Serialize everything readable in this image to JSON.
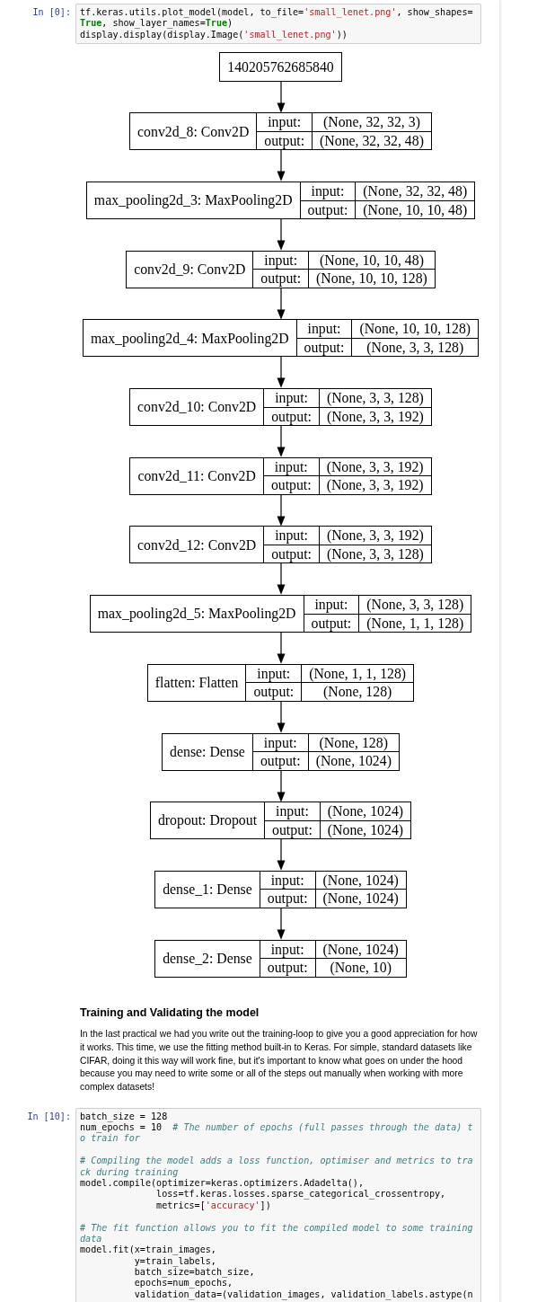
{
  "cells": [
    {
      "kind": "code",
      "prompt": "In [0]:",
      "blocks": [
        [
          [
            {
              "kind": "plain",
              "text": "tf.keras.utils.plot_model(model, to_file="
            },
            {
              "kind": "string",
              "text": "'small_lenet.png'"
            },
            {
              "kind": "plain",
              "text": ", show_shapes="
            }
          ],
          [
            {
              "kind": "keyword",
              "text": "True"
            },
            {
              "kind": "plain",
              "text": ", show_layer_names="
            },
            {
              "kind": "keyword",
              "text": "True"
            },
            {
              "kind": "plain",
              "text": ")"
            }
          ],
          [
            {
              "kind": "plain",
              "text": "display.display(display.Image("
            },
            {
              "kind": "string",
              "text": "'small_lenet.png'"
            },
            {
              "kind": "plain",
              "text": "))"
            }
          ]
        ]
      ],
      "output": {
        "kind": "model_graph",
        "root": "140205762685840",
        "layers": [
          {
            "name": "conv2d_8: Conv2D",
            "input_label": "input:",
            "input": "(None, 32, 32, 3)",
            "output_label": "output:",
            "output": "(None, 32, 32, 48)"
          },
          {
            "name": "max_pooling2d_3: MaxPooling2D",
            "input_label": "input:",
            "input": "(None, 32, 32, 48)",
            "output_label": "output:",
            "output": "(None, 10, 10, 48)"
          },
          {
            "name": "conv2d_9: Conv2D",
            "input_label": "input:",
            "input": "(None, 10, 10, 48)",
            "output_label": "output:",
            "output": "(None, 10, 10, 128)"
          },
          {
            "name": "max_pooling2d_4: MaxPooling2D",
            "input_label": "input:",
            "input": "(None, 10, 10, 128)",
            "output_label": "output:",
            "output": "(None, 3, 3, 128)"
          },
          {
            "name": "conv2d_10: Conv2D",
            "input_label": "input:",
            "input": "(None, 3, 3, 128)",
            "output_label": "output:",
            "output": "(None, 3, 3, 192)"
          },
          {
            "name": "conv2d_11: Conv2D",
            "input_label": "input:",
            "input": "(None, 3, 3, 192)",
            "output_label": "output:",
            "output": "(None, 3, 3, 192)"
          },
          {
            "name": "conv2d_12: Conv2D",
            "input_label": "input:",
            "input": "(None, 3, 3, 192)",
            "output_label": "output:",
            "output": "(None, 3, 3, 128)"
          },
          {
            "name": "max_pooling2d_5: MaxPooling2D",
            "input_label": "input:",
            "input": "(None, 3, 3, 128)",
            "output_label": "output:",
            "output": "(None, 1, 1, 128)"
          },
          {
            "name": "flatten: Flatten",
            "input_label": "input:",
            "input": "(None, 1, 1, 128)",
            "output_label": "output:",
            "output": "(None, 128)"
          },
          {
            "name": "dense: Dense",
            "input_label": "input:",
            "input": "(None, 128)",
            "output_label": "output:",
            "output": "(None, 1024)"
          },
          {
            "name": "dropout: Dropout",
            "input_label": "input:",
            "input": "(None, 1024)",
            "output_label": "output:",
            "output": "(None, 1024)"
          },
          {
            "name": "dense_1: Dense",
            "input_label": "input:",
            "input": "(None, 1024)",
            "output_label": "output:",
            "output": "(None, 1024)"
          },
          {
            "name": "dense_2: Dense",
            "input_label": "input:",
            "input": "(None, 1024)",
            "output_label": "output:",
            "output": "(None, 10)"
          }
        ]
      }
    },
    {
      "kind": "markdown",
      "heading": "Training and Validating the model",
      "paragraph": "In the last practical we had you write out the training-loop to give you a good appreciation for how it works. This time, we use the fitting method built-in to Keras. For simple, standard datasets like CIFAR, doing it this way will work fine, but it's important to know what goes on under the hood because you may need to write some or all of the steps out manually when working with more complex datasets!"
    },
    {
      "kind": "code",
      "prompt": "In [10]:",
      "blocks": [
        [
          [
            {
              "kind": "plain",
              "text": "batch_size = 128"
            }
          ],
          [
            {
              "kind": "plain",
              "text": "num_epochs = 10  "
            },
            {
              "kind": "comment",
              "text": "# The number of epochs (full passes through the data) t"
            }
          ],
          [
            {
              "kind": "comment",
              "text": "o train for"
            }
          ]
        ],
        [
          [
            {
              "kind": "comment",
              "text": "# Compiling the model adds a loss function, optimiser and metrics to tra"
            }
          ],
          [
            {
              "kind": "comment",
              "text": "ck during training"
            }
          ],
          [
            {
              "kind": "plain",
              "text": "model.compile(optimizer=keras.optimizers.Adadelta(),"
            }
          ],
          [
            {
              "kind": "plain",
              "text": "              loss=tf.keras.losses.sparse_categorical_crossentropy,"
            }
          ],
          [
            {
              "kind": "plain",
              "text": "              metrics=["
            },
            {
              "kind": "string",
              "text": "'accuracy'"
            },
            {
              "kind": "plain",
              "text": "])"
            }
          ]
        ],
        [
          [
            {
              "kind": "comment",
              "text": "# The fit function allows you to fit the compiled model to some training"
            }
          ],
          [
            {
              "kind": "comment",
              "text": "data"
            }
          ],
          [
            {
              "kind": "plain",
              "text": "model.fit(x=train_images,"
            }
          ],
          [
            {
              "kind": "plain",
              "text": "          y=train_labels,"
            }
          ],
          [
            {
              "kind": "plain",
              "text": "          batch_size=batch_size,"
            }
          ],
          [
            {
              "kind": "plain",
              "text": "          epochs=num_epochs,"
            }
          ],
          [
            {
              "kind": "plain",
              "text": "          validation_data=(validation_images, validation_labels.astype(n"
            }
          ]
        ]
      ]
    }
  ]
}
